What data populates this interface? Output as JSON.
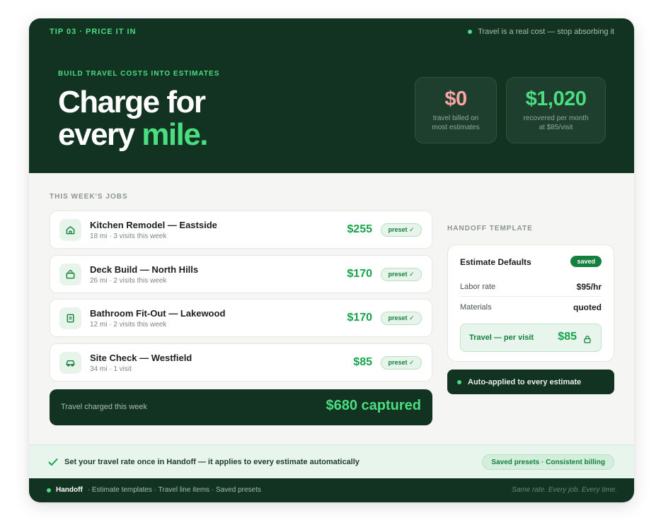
{
  "hero": {
    "tip_label": "TIP 03 · PRICE IT IN",
    "tagline": "Travel is a real cost — stop absorbing it",
    "eyebrow": "BUILD TRAVEL COSTS INTO ESTIMATES",
    "headline_line1": "Charge for",
    "headline_line2_start": "every",
    "headline_line2_accent": "mile.",
    "stats": [
      {
        "value": "$0",
        "caption_line1": "travel billed on",
        "caption_line2": "most estimates",
        "color": "#fda4a4"
      },
      {
        "value": "$1,020",
        "caption_line1": "recovered per month",
        "caption_line2": "at $85/visit",
        "color": "#4ade80"
      }
    ]
  },
  "jobs": {
    "section_label": "THIS WEEK'S JOBS",
    "items": [
      {
        "title": "Kitchen Remodel — Eastside",
        "meta": "18 mi · 3 visits this week",
        "price": "$255",
        "badge": "preset ✓",
        "icon": "house-icon"
      },
      {
        "title": "Deck Build — North Hills",
        "meta": "26 mi · 2 visits this week",
        "price": "$170",
        "badge": "preset ✓",
        "icon": "briefcase-icon"
      },
      {
        "title": "Bathroom Fit-Out — Lakewood",
        "meta": "12 mi · 2 visits this week",
        "price": "$170",
        "badge": "preset ✓",
        "icon": "document-icon"
      },
      {
        "title": "Site Check — Westfield",
        "meta": "34 mi · 1 visit",
        "price": "$85",
        "badge": "preset ✓",
        "icon": "car-icon"
      }
    ],
    "total_label": "Travel charged this week",
    "total_value": "$680 captured"
  },
  "template": {
    "section_label": "HANDOFF TEMPLATE",
    "title": "Estimate Defaults",
    "badge": "saved",
    "rows": [
      {
        "key": "Labor rate",
        "value": "$95/hr"
      },
      {
        "key": "Materials",
        "value": "quoted"
      }
    ],
    "travel_key": "Travel — per visit",
    "travel_value": "$85",
    "auto_applied": "Auto-applied to every estimate"
  },
  "banner": {
    "text": "Set your travel rate once in Handoff — it applies to every estimate automatically",
    "pill": "Saved presets · Consistent billing"
  },
  "footer": {
    "brand": "Handoff",
    "links": "· Estimate templates · Travel line items · Saved presets",
    "slogan": "Same rate. Every job. Every time."
  },
  "colors": {
    "dark_green": "#133322",
    "accent_green": "#4ade80",
    "price_green": "#16a34a",
    "salmon": "#fda4a4"
  }
}
